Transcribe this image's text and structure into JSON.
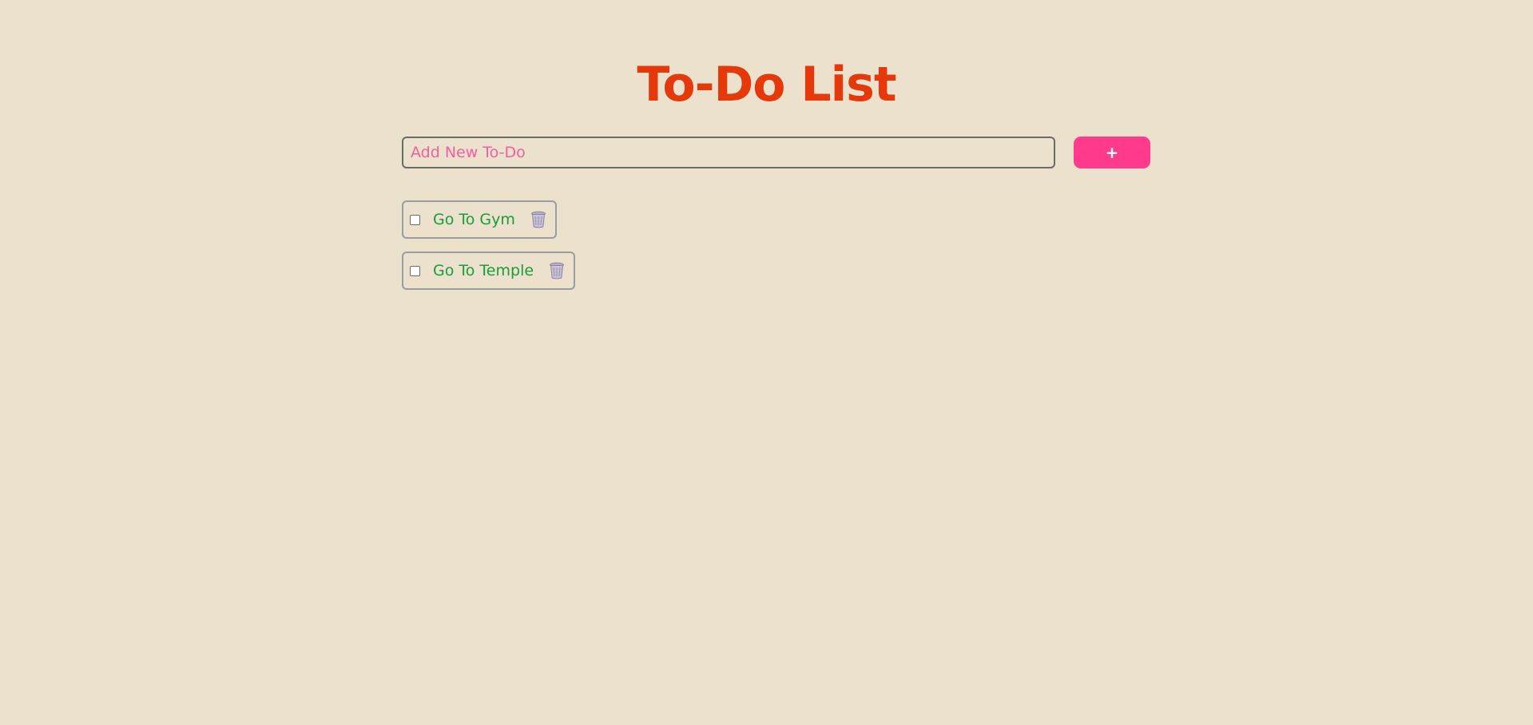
{
  "header": {
    "title": "To-Do List"
  },
  "form": {
    "input_placeholder": "Add New To-Do",
    "input_value": "",
    "add_button_label": "+"
  },
  "todos": [
    {
      "text": "Go To Gym",
      "completed": false,
      "delete_icon": "trash-icon"
    },
    {
      "text": "Go To Temple",
      "completed": false,
      "delete_icon": "trash-icon"
    }
  ],
  "colors": {
    "background": "#ece1cc",
    "title": "#e5380b",
    "placeholder": "#f060a0",
    "add_button": "#ff3a8c",
    "todo_text": "#1b9c3a"
  }
}
